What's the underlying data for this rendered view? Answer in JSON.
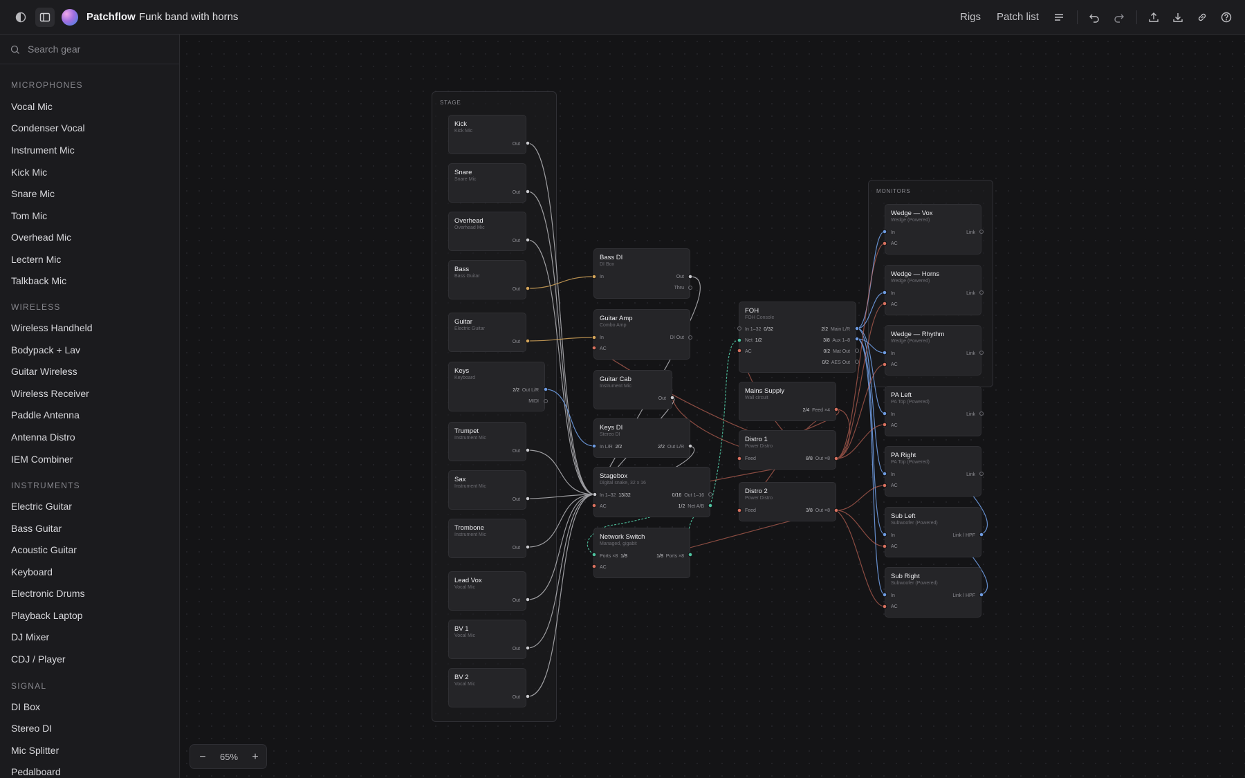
{
  "topbar": {
    "theme_icon": "half-circle-icon",
    "sidebar_icon": "sidebar-panel-icon",
    "app_name": "Patchflow",
    "doc_name": "Funk band with horns",
    "rigs_label": "Rigs",
    "patch_list_label": "Patch list",
    "icons": [
      "menu-lines-icon",
      "undo-icon",
      "redo-icon",
      "upload-icon",
      "download-icon",
      "link-icon",
      "help-icon"
    ]
  },
  "sidebar": {
    "search_placeholder": "Search gear",
    "sections": [
      {
        "title": "MICROPHONES",
        "items": [
          "Vocal Mic",
          "Condenser Vocal",
          "Instrument Mic",
          "Kick Mic",
          "Snare Mic",
          "Tom Mic",
          "Overhead Mic",
          "Lectern Mic",
          "Talkback Mic"
        ]
      },
      {
        "title": "WIRELESS",
        "items": [
          "Wireless Handheld",
          "Bodypack + Lav",
          "Guitar Wireless",
          "Wireless Receiver",
          "Paddle Antenna",
          "Antenna Distro",
          "IEM Combiner"
        ]
      },
      {
        "title": "INSTRUMENTS",
        "items": [
          "Electric Guitar",
          "Bass Guitar",
          "Acoustic Guitar",
          "Keyboard",
          "Electronic Drums",
          "Playback Laptop",
          "DJ Mixer",
          "CDJ / Player"
        ]
      },
      {
        "title": "SIGNAL",
        "items": [
          "DI Box",
          "Stereo DI",
          "Mic Splitter",
          "Pedalboard"
        ]
      }
    ]
  },
  "groups": {
    "stage": "STAGE",
    "monitors": "MONITORS"
  },
  "nodes": {
    "kick": {
      "title": "Kick",
      "sub": "Kick Mic",
      "out": "Out"
    },
    "snare": {
      "title": "Snare",
      "sub": "Snare Mic",
      "out": "Out"
    },
    "overhead": {
      "title": "Overhead",
      "sub": "Overhead Mic",
      "out": "Out"
    },
    "bass": {
      "title": "Bass",
      "sub": "Bass Guitar",
      "out": "Out"
    },
    "guitar": {
      "title": "Guitar",
      "sub": "Electric Guitar",
      "out": "Out"
    },
    "keys": {
      "title": "Keys",
      "sub": "Keyboard",
      "count": "2/2",
      "out": "Out L/R",
      "midi": "MIDI"
    },
    "trumpet": {
      "title": "Trumpet",
      "sub": "Instrument Mic",
      "out": "Out"
    },
    "sax": {
      "title": "Sax",
      "sub": "Instrument Mic",
      "out": "Out"
    },
    "trombone": {
      "title": "Trombone",
      "sub": "Instrument Mic",
      "out": "Out"
    },
    "leadvox": {
      "title": "Lead Vox",
      "sub": "Vocal Mic",
      "out": "Out"
    },
    "bv1": {
      "title": "BV 1",
      "sub": "Vocal Mic",
      "out": "Out"
    },
    "bv2": {
      "title": "BV 2",
      "sub": "Vocal Mic",
      "out": "Out"
    },
    "bassdi": {
      "title": "Bass DI",
      "sub": "DI Box",
      "in": "In",
      "out": "Out",
      "thru": "Thru"
    },
    "guitaramp": {
      "title": "Guitar Amp",
      "sub": "Combo Amp",
      "in": "In",
      "ac": "AC",
      "diout": "DI Out"
    },
    "guitarcab": {
      "title": "Guitar Cab",
      "sub": "Instrument Mic",
      "out": "Out"
    },
    "keysdi": {
      "title": "Keys DI",
      "sub": "Stereo DI",
      "in": "In L/R",
      "in_count": "2/2",
      "out_count": "2/2",
      "out": "Out L/R"
    },
    "stagebox": {
      "title": "Stagebox",
      "sub": "Digital snake, 32 x 16",
      "in": "In 1–32",
      "in_count": "13/32",
      "ac": "AC",
      "out_count": "0/16",
      "out": "Out 1–16",
      "net_count": "1/2",
      "net": "Net A/B"
    },
    "netswitch": {
      "title": "Network Switch",
      "sub": "Managed, gigabit",
      "ports_in": "Ports ×8",
      "ports_in_count": "1/8",
      "ac": "AC",
      "ports_out_count": "1/8",
      "ports_out": "Ports ×8"
    },
    "foh": {
      "title": "FOH",
      "sub": "FOH Console",
      "in": "In 1–32",
      "in_count": "0/32",
      "net": "Net",
      "net_count": "1/2",
      "ac": "AC",
      "main_count": "2/2",
      "main": "Main L/R",
      "aux_count": "3/8",
      "aux": "Aux 1–8",
      "mat_count": "0/2",
      "mat": "Mat Out",
      "aes_count": "0/2",
      "aes": "AES Out"
    },
    "mains": {
      "title": "Mains Supply",
      "sub": "Wall circuit",
      "count": "2/4",
      "feed": "Feed ×4"
    },
    "distro1": {
      "title": "Distro 1",
      "sub": "Power Distro",
      "feed": "Feed",
      "count": "8/8",
      "out": "Out ×8"
    },
    "distro2": {
      "title": "Distro 2",
      "sub": "Power Distro",
      "feed": "Feed",
      "count": "3/8",
      "out": "Out ×8"
    },
    "wedgevox": {
      "title": "Wedge — Vox",
      "sub": "Wedge (Powered)",
      "in": "In",
      "ac": "AC",
      "link": "Link"
    },
    "wedgehorns": {
      "title": "Wedge — Horns",
      "sub": "Wedge (Powered)",
      "in": "In",
      "ac": "AC",
      "link": "Link"
    },
    "wedgerhythm": {
      "title": "Wedge — Rhythm",
      "sub": "Wedge (Powered)",
      "in": "In",
      "ac": "AC",
      "link": "Link"
    },
    "paleft": {
      "title": "PA Left",
      "sub": "PA Top (Powered)",
      "in": "In",
      "ac": "AC",
      "link": "Link"
    },
    "paright": {
      "title": "PA Right",
      "sub": "PA Top (Powered)",
      "in": "In",
      "ac": "AC",
      "link": "Link"
    },
    "subleft": {
      "title": "Sub Left",
      "sub": "Subwoofer (Powered)",
      "in": "In",
      "ac": "AC",
      "link": "Link / HPF"
    },
    "subright": {
      "title": "Sub Right",
      "sub": "Subwoofer (Powered)",
      "in": "In",
      "ac": "AC",
      "link": "Link / HPF"
    }
  },
  "zoom": {
    "minus": "−",
    "value": "65%",
    "plus": "+"
  },
  "colors": {
    "audio": "#c9c9cd",
    "instrument": "#d4a55a",
    "stereo": "#6e9be0",
    "network": "#4fc3a0",
    "power": "#d9715f"
  }
}
